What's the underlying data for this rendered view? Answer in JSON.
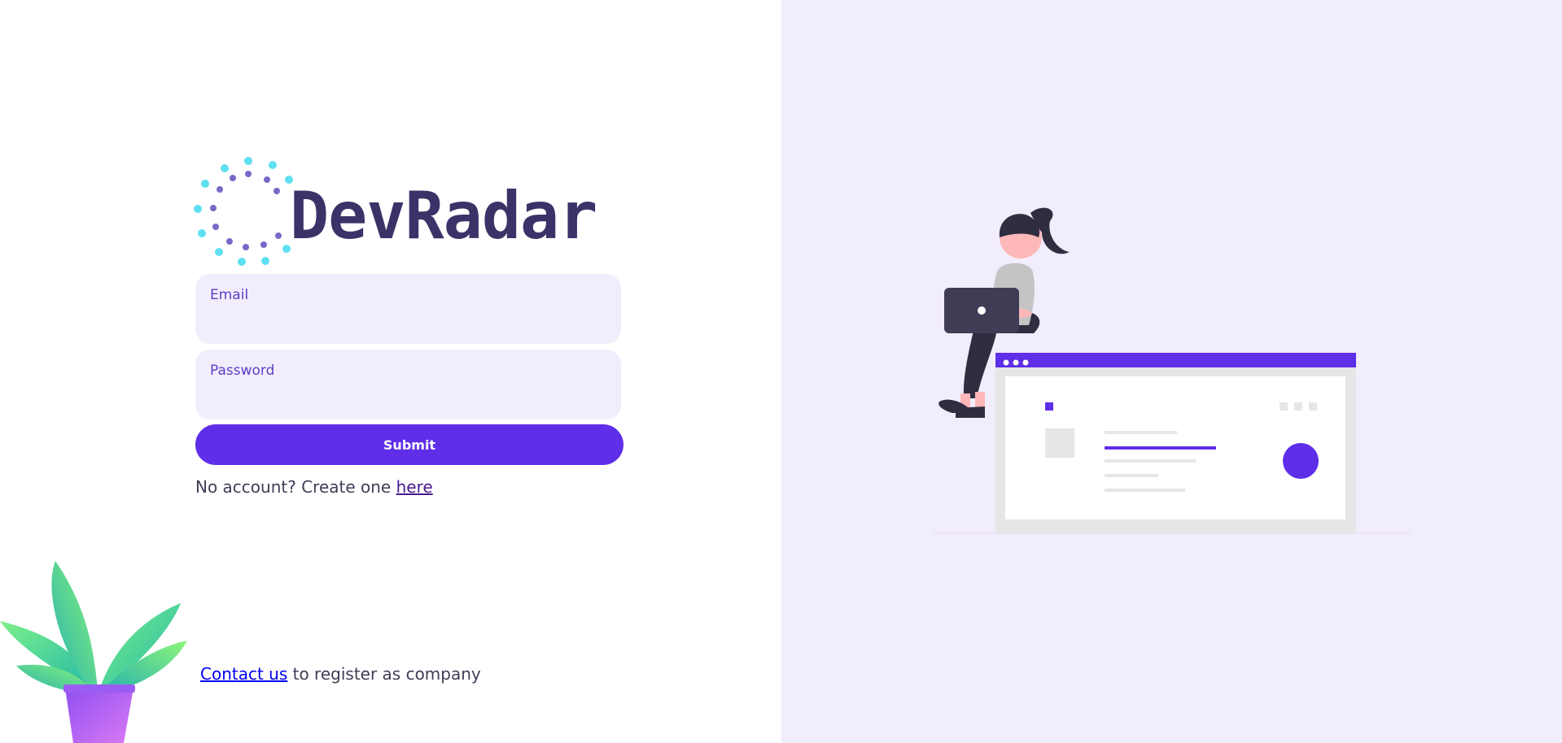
{
  "brand": {
    "name": "DevRadar",
    "colors": {
      "dark": "#3b3368",
      "accent": "#5f2ee8",
      "dot_cyan": "#5fe0f0",
      "dot_purple": "#7b68c8"
    }
  },
  "login_form": {
    "email": {
      "label": "Email",
      "value": ""
    },
    "password": {
      "label": "Password",
      "value": ""
    },
    "submit_label": "Submit"
  },
  "signup": {
    "prefix": "No account? Create one ",
    "link_label": "here"
  },
  "company": {
    "link_label": "Contact us",
    "suffix": " to register as company"
  },
  "theme": {
    "left_background": "#ffffff",
    "right_background": "#f1edfc",
    "field_background": "#f1edfc"
  },
  "illustration": {
    "icon": "woman-with-laptop-on-browser-window-illustration"
  },
  "decoration": {
    "icon": "potted-plant-icon"
  }
}
